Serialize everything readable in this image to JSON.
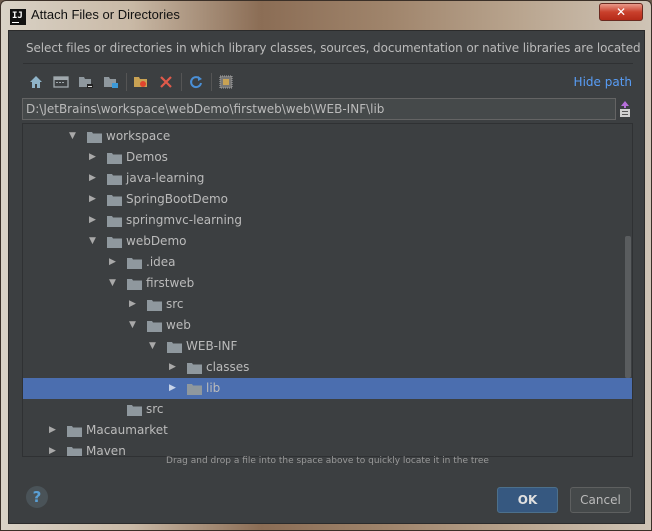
{
  "window": {
    "title": "Attach Files or Directories",
    "app_icon_text": "IJ",
    "close_symbol": "✕"
  },
  "description": "Select files or directories in which library classes, sources, documentation or native libraries are located",
  "toolbar": {
    "buttons": [
      {
        "name": "home-directory",
        "icon": "home-icon"
      },
      {
        "name": "desktop-directory",
        "icon": "desktop-icon"
      },
      {
        "name": "project-directory",
        "icon": "project-folder-icon"
      },
      {
        "name": "module-directory",
        "icon": "module-folder-icon"
      },
      {
        "name": "new-folder",
        "icon": "new-folder-icon"
      },
      {
        "name": "delete",
        "icon": "delete-icon"
      },
      {
        "name": "refresh",
        "icon": "refresh-icon"
      },
      {
        "name": "show-hidden",
        "icon": "show-hidden-icon"
      }
    ],
    "hide_path_label": "Hide path"
  },
  "path": {
    "value": "D:\\JetBrains\\workspace\\webDemo\\firstweb\\web\\WEB-INF\\lib"
  },
  "tree": {
    "rows": [
      {
        "label": "workspace",
        "level": 0,
        "state": "expanded"
      },
      {
        "label": "Demos",
        "level": 1,
        "state": "collapsed"
      },
      {
        "label": "java-learning",
        "level": 1,
        "state": "collapsed"
      },
      {
        "label": "SpringBootDemo",
        "level": 1,
        "state": "collapsed"
      },
      {
        "label": "springmvc-learning",
        "level": 1,
        "state": "collapsed"
      },
      {
        "label": "webDemo",
        "level": 1,
        "state": "expanded"
      },
      {
        "label": ".idea",
        "level": 2,
        "state": "collapsed"
      },
      {
        "label": "firstweb",
        "level": 2,
        "state": "expanded"
      },
      {
        "label": "src",
        "level": 3,
        "state": "collapsed"
      },
      {
        "label": "web",
        "level": 3,
        "state": "expanded"
      },
      {
        "label": "WEB-INF",
        "level": 4,
        "state": "expanded"
      },
      {
        "label": "classes",
        "level": 5,
        "state": "collapsed"
      },
      {
        "label": "lib",
        "level": 5,
        "state": "collapsed",
        "selected": true
      },
      {
        "label": "src",
        "level": 2,
        "state": "leaf"
      },
      {
        "label": "Macaumarket",
        "level": -1,
        "state": "collapsed"
      },
      {
        "label": "Maven",
        "level": -1,
        "state": "collapsed"
      }
    ]
  },
  "hint": "Drag and drop a file into the space above to quickly locate it in the tree",
  "buttons": {
    "help": "?",
    "ok": "OK",
    "cancel": "Cancel"
  },
  "colors": {
    "background": "#3c3f41",
    "selection": "#4b6eaf",
    "link": "#589df6",
    "ok_button": "#365880"
  }
}
